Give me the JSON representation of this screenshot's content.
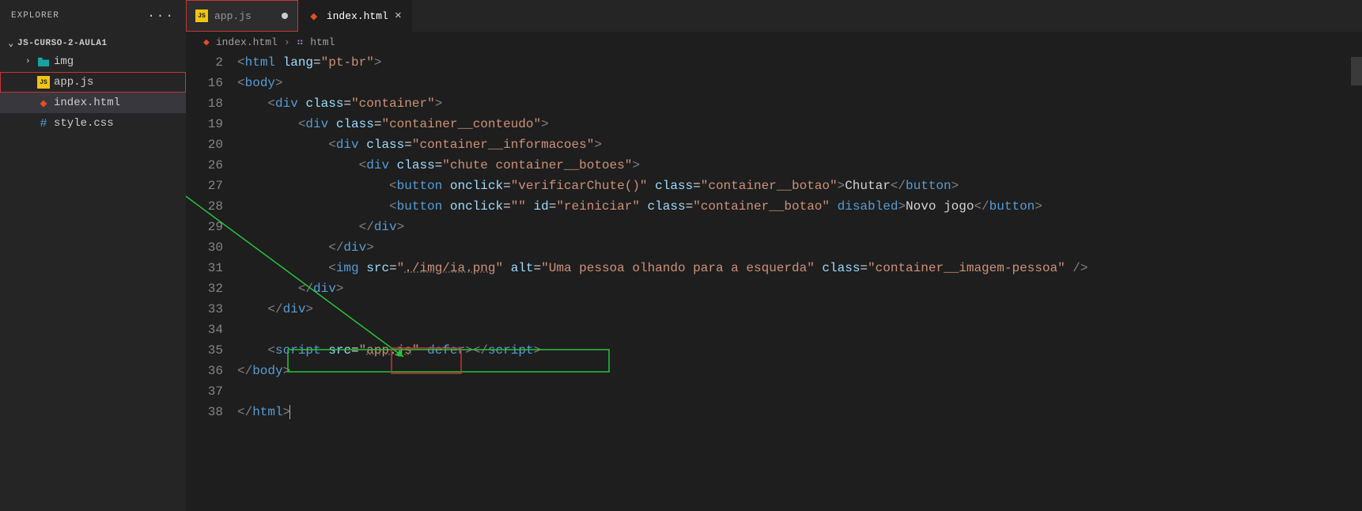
{
  "sidebar": {
    "title": "EXPLORER",
    "actions_glyph": "···",
    "root": "JS-CURSO-2-AULA1",
    "items": [
      {
        "name": "img",
        "kind": "folder",
        "chevron": "›"
      },
      {
        "name": "app.js",
        "kind": "js",
        "highlight_red": true
      },
      {
        "name": "index.html",
        "kind": "html",
        "selected": true
      },
      {
        "name": "style.css",
        "kind": "css"
      }
    ]
  },
  "tabs": [
    {
      "label": "app.js",
      "kind": "js",
      "dirty": true,
      "active": false,
      "highlight_red": true
    },
    {
      "label": "index.html",
      "kind": "html",
      "dirty": false,
      "active": true
    }
  ],
  "breadcrumbs": {
    "file": "index.html",
    "node": "html"
  },
  "code": {
    "line_numbers": [
      2,
      16,
      18,
      19,
      20,
      26,
      27,
      28,
      29,
      30,
      31,
      32,
      33,
      34,
      35,
      36,
      37,
      38
    ],
    "lang": "pt-br",
    "div_class_container": "container",
    "div_class_conteudo": "container__conteudo",
    "div_class_informacoes": "container__informacoes",
    "div_class_chute": "chute container__botoes",
    "btn_onclick": "verificarChute()",
    "btn_class": "container__botao",
    "btn1_text": "Chutar",
    "btn2_onclick": "",
    "btn2_id": "reiniciar",
    "btn2_class": "container__botao",
    "btn2_disabled": "disabled",
    "btn2_text": "Novo jogo",
    "img_src": "./img/ia.png",
    "img_alt": "Uma pessoa olhando para a esquerda",
    "img_class": "container__imagem-pessoa",
    "script_src": "app.js",
    "script_defer": "defer"
  },
  "annotations": {
    "arrow_color": "#27c439",
    "red_box_color": "#c73434",
    "green_box_color": "#27c439"
  }
}
